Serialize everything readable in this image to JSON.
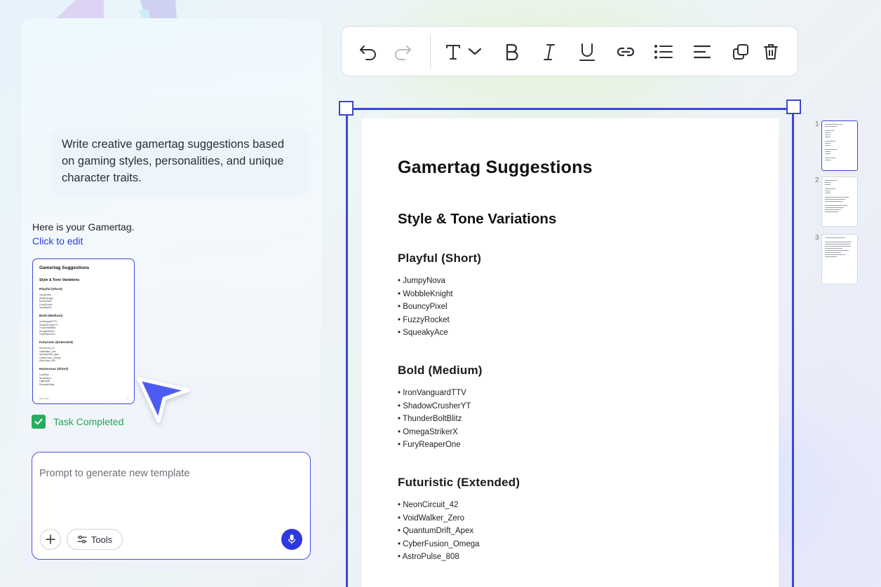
{
  "chat": {
    "user_message": "Write creative gamertag suggestions based on gaming styles, personalities, and unique character traits.",
    "reply_text": "Here is your Gamertag.",
    "edit_link": "Click to edit",
    "task_status": "Task Completed",
    "prompt_placeholder": "Prompt to generate new template",
    "tools_label": "Tools"
  },
  "thumbnail": {
    "title": "Gamertag Suggestions",
    "subtitle": "Style & Tone Variations",
    "sections": [
      {
        "heading": "Playful (Short)",
        "items": [
          "JumpyNova",
          "WobbleKnight",
          "BouncyPixel",
          "FuzzyRocket",
          "SqueakyAce"
        ]
      },
      {
        "heading": "Bold (Medium)",
        "items": [
          "IronVanguardTTV",
          "ShadowCrusherYT",
          "ThunderBoltBlitz",
          "OmegaStrikerX",
          "FuryReaperOne"
        ]
      },
      {
        "heading": "Futuristic (Extended)",
        "items": [
          "NeonCircuit_42",
          "VoidWalker_Zero",
          "QuantumDrift_Apex",
          "CyberFusion_Omega",
          "AstroPulse_808"
        ]
      },
      {
        "heading": "Humorous (Short)",
        "items": [
          "LootNinja",
          "NoobSauce",
          "LagKing99",
          "RespawnMage"
        ]
      }
    ],
    "footer_left": "Gamertag",
    "footer_right": "1"
  },
  "toolbar": {
    "icons": [
      "undo-icon",
      "redo-icon",
      "text-style-icon",
      "chevron-down-icon",
      "bold-icon",
      "italic-icon",
      "underline-icon",
      "link-icon",
      "bullet-list-icon",
      "align-left-icon",
      "duplicate-icon",
      "delete-icon"
    ]
  },
  "document": {
    "title": "Gamertag Suggestions",
    "subtitle": "Style & Tone Variations",
    "sections": [
      {
        "heading": "Playful (Short)",
        "items": [
          "JumpyNova",
          "WobbleKnight",
          "BouncyPixel",
          "FuzzyRocket",
          "SqueakyAce"
        ]
      },
      {
        "heading": "Bold (Medium)",
        "items": [
          "IronVanguardTTV",
          "ShadowCrusherYT",
          "ThunderBoltBlitz",
          "OmegaStrikerX",
          "FuryReaperOne"
        ]
      },
      {
        "heading": "Futuristic (Extended)",
        "items": [
          "NeonCircuit_42",
          "VoidWalker_Zero",
          "QuantumDrift_Apex",
          "CyberFusion_Omega",
          "AstroPulse_808"
        ]
      }
    ]
  },
  "pages": [
    {
      "number": "1",
      "active": true
    },
    {
      "number": "2",
      "active": false
    },
    {
      "number": "3",
      "active": false
    }
  ],
  "colors": {
    "accent": "#3b47d6",
    "mic_button": "#2d38e0",
    "success": "#27ad5c",
    "link": "#2f3ad8"
  }
}
